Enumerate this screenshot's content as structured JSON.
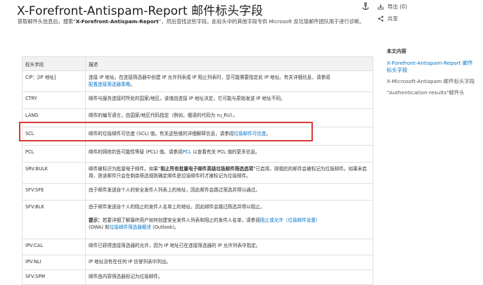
{
  "page": {
    "title": "X-Forefront-Antispam-Report 邮件标头字段",
    "intro_pre": "获取邮件头信息后，搜索“",
    "intro_bold": "X-Forefront-Antispam-Report",
    "intro_post": "”，然后查找这些字段。此标头中的其他字段专供 Microsoft 反垃圾邮件团队用于进行诊断。"
  },
  "toolbar": {
    "anchor_icon": "anchor-icon",
    "export_label": "导出 (0)",
    "export_icon": "export-icon",
    "share_label": "共享",
    "share_icon": "share-icon"
  },
  "table": {
    "header_field": "标头字段",
    "header_desc": "描述",
    "rows": [
      {
        "field": "CIP：[IP 地址]",
        "desc": "连接 IP 地址。在连接筛选器中创建 IP 允许列表或 IP 阻止列表时，您可能需要指定此 IP 地址。有关详细信息，请参阅",
        "link": "配置连接筛选器策略",
        "desc_after": "。"
      },
      {
        "field": "CTRY",
        "desc": "邮件与服务连接时所处的国家/地区。该值由连接 IP 地址决定，它可能与原始发送 IP 地址不同。"
      },
      {
        "field": "LANG",
        "desc": "邮件的编写语言，由国家/地区代码指定（例如，俄语的代码为 ru_RU）。"
      },
      {
        "field": "SCL",
        "desc": "邮件的垃圾邮件可信度 (SCL) 值。有关这些值的详细解释信息，请参阅",
        "link": "垃圾邮件可信度",
        "desc_after": "。"
      },
      {
        "field": "PCL",
        "desc": "邮件的网络钓鱼可能性等级 (PCL) 值。请参阅",
        "link": "PCL",
        "desc_after": " 以查看有关 PCL 值的更多信息。"
      },
      {
        "field": "SRV:BULK",
        "desc_pre": "邮件被标识为批量电子邮件。如果“",
        "desc_bold": "阻止所有批量电子邮件高级垃圾邮件筛选选项",
        "desc": "”已启用，则相应的邮件会被标记为垃圾邮件。如果未启用，则该邮件只会在剩余筛选规则确定邮件是垃圾邮件时才被标记为垃圾邮件。"
      },
      {
        "field": "SFV:SFE",
        "desc": "由于邮件发送自个人的安全发件人列表上的地址，因此邮件会跳过筛选并得以通过。"
      },
      {
        "field": "SFV:BLK",
        "desc": "由于邮件发送自个人的阻止的发件人名单上的地址，因此邮件会跳过筛选并得以阻止。",
        "tip_label": "提示：",
        "tip_text": "若要详细了解最终用户如何创建安全发件人列表和阻止的发件人名单，请参阅",
        "tip_link1": "阻止或允许（垃圾邮件设置）",
        "tip_mid": "(OWA) 和",
        "tip_link2": "垃圾邮件筛选器概述",
        "tip_end": " (Outlook)。"
      },
      {
        "field": "IPV:CAL",
        "desc": "邮件已获得连接筛选器的允许，因为 IP 地址已在连接筛选器的 IP 允许列表中指定。"
      },
      {
        "field": "IPV:NLI",
        "desc": "IP 地址没有在任何 IP 信誉列表中列出。"
      },
      {
        "field": "SFV:SPM",
        "desc": "邮件由内容筛选器标记为垃圾邮件。"
      }
    ]
  },
  "toc": {
    "heading": "本文内容",
    "items": [
      {
        "label": "X-Forefront-Antispam-Report 邮件标头字段",
        "active": true
      },
      {
        "label": "X-Microsoft-Antispam 邮件标头字段",
        "active": false
      },
      {
        "label": "\"Authentication-results\"邮件头",
        "active": false
      }
    ]
  },
  "colors": {
    "link": "#0072c6",
    "highlight_box": "#d93939",
    "header_bg": "#f2f2f2"
  }
}
